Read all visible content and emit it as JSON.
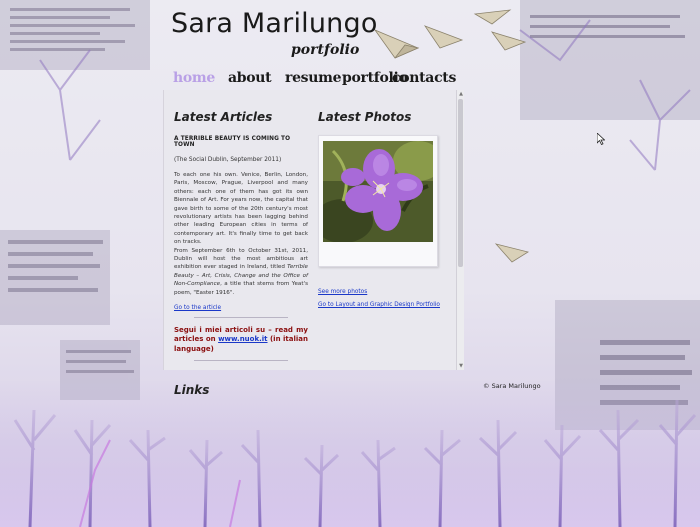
{
  "header": {
    "title": "Sara Marilungo",
    "subtitle": "portfolio"
  },
  "nav": {
    "items": [
      {
        "label": "home",
        "active": true
      },
      {
        "label": "about",
        "active": false
      },
      {
        "label": "resume",
        "active": false
      },
      {
        "label": "portfolio",
        "active": false
      },
      {
        "label": "contacts",
        "active": false
      }
    ]
  },
  "articles": {
    "heading": "Latest Articles",
    "title": "A TERRIBLE BEAUTY IS COMING TO TOWN",
    "source": "(The Social Dublin, September 2011)",
    "body_1": "To each one his own. Venice, Berlin, London, Paris, Moscow, Prague, Liverpool and many others: each one of them has got its own Biennale of Art. For years now, the capital that gave birth to some of the 20th century's most revolutionary artists has been lagging behind other leading European cities in terms of contemporary art. It's finally time to get back on tracks.",
    "body_2_start": "From September 6th to October 31st, 2011, Dublin will host the most ambitious art exhibition ever staged in Ireland, titled ",
    "body_2_italic": "Terrible Beauty – Art, Crisis, Change and the Office of Non-Compliance",
    "body_2_end": ", a title that stems from Yeat's poem, \"Easter 1916\".",
    "link": "Go to the article"
  },
  "promo": {
    "text": "Segui i miei articoli su – read my articles on ",
    "link": "www.nuok.it",
    "suffix": " (in italian language)"
  },
  "links": {
    "heading": "Links"
  },
  "photos": {
    "heading": "Latest Photos",
    "see_more": "See more photos",
    "portfolio_link": "Go to Layout and Graphic Design Portfolio"
  },
  "footer": {
    "copyright": "© Sara Marilungo"
  },
  "colors": {
    "nav_active": "#b9a0e6",
    "link": "#1a38c8",
    "promo": "#8b0f0f",
    "accent_purple": "#9a62d8"
  }
}
